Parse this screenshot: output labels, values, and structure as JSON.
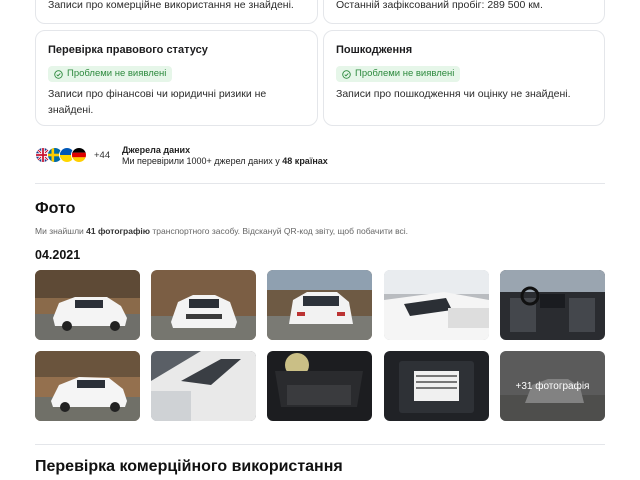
{
  "top_cards": {
    "left_text": "Записи про комерційне використання не знайдені.",
    "right_text": "Останній зафіксований пробіг: 289 500 км."
  },
  "legal_card": {
    "title": "Перевірка правового статусу",
    "badge": "Проблеми не виявлені",
    "text_line1": "Записи про фінансові чи юридичні ризики не",
    "text_line2": "знайдені."
  },
  "damage_card": {
    "title": "Пошкодження",
    "badge": "Проблеми не виявлені",
    "text": "Записи про пошкодження чи оцінку не знайдені."
  },
  "sources": {
    "more_count": "+44",
    "title": "Джерела даних",
    "sub_prefix": "Ми перевірили 1000+ джерел даних у ",
    "sub_bold": "48 країнах"
  },
  "photos": {
    "heading": "Фото",
    "sub_prefix": "Ми знайшли ",
    "sub_bold": "41 фотографію",
    "sub_suffix": " транспортного засобу. Відскануй QR-код звіту, щоб побачити всі.",
    "date": "04.2021",
    "more_label": "+31 фотографія"
  },
  "next_section": {
    "heading": "Перевірка комерційного використання"
  },
  "colors": {
    "badge_bg": "#e6f6e9",
    "badge_text": "#2d8a3e",
    "border": "#e4e6ea"
  }
}
